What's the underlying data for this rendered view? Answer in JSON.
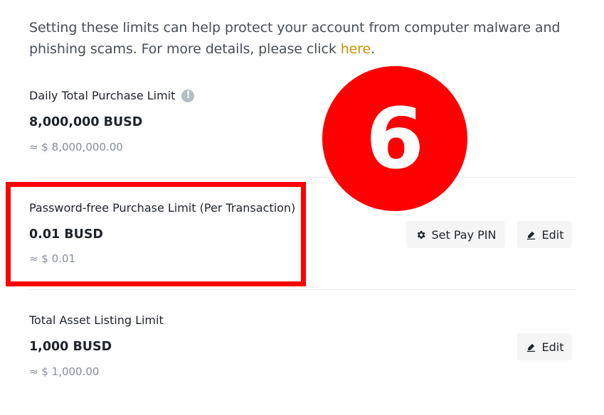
{
  "intro": {
    "text": "Setting these limits can help protect your account from computer malware and phishing scams. For more details, please click ",
    "link_label": "here",
    "trailing": "."
  },
  "limits": [
    {
      "label": "Daily Total Purchase Limit",
      "amount": "8,000,000 BUSD",
      "approx": "≈ $ 8,000,000.00",
      "info_icon": "exclamation-circle-icon"
    },
    {
      "label": "Password-free Purchase Limit (Per Transaction)",
      "amount": "0.01 BUSD",
      "approx": "≈ $ 0.01",
      "set_pin_label": "Set Pay PIN",
      "edit_label": "Edit"
    },
    {
      "label": "Total Asset Listing Limit",
      "amount": "1,000 BUSD",
      "approx": "≈ $ 1,000.00",
      "edit_label": "Edit"
    }
  ],
  "annotation": {
    "step_number": "6",
    "color": "#ff0000"
  },
  "colors": {
    "link": "#c99400",
    "primary_text": "#1e2329",
    "secondary_text": "#848e9c",
    "button_bg": "#f5f5f5"
  }
}
